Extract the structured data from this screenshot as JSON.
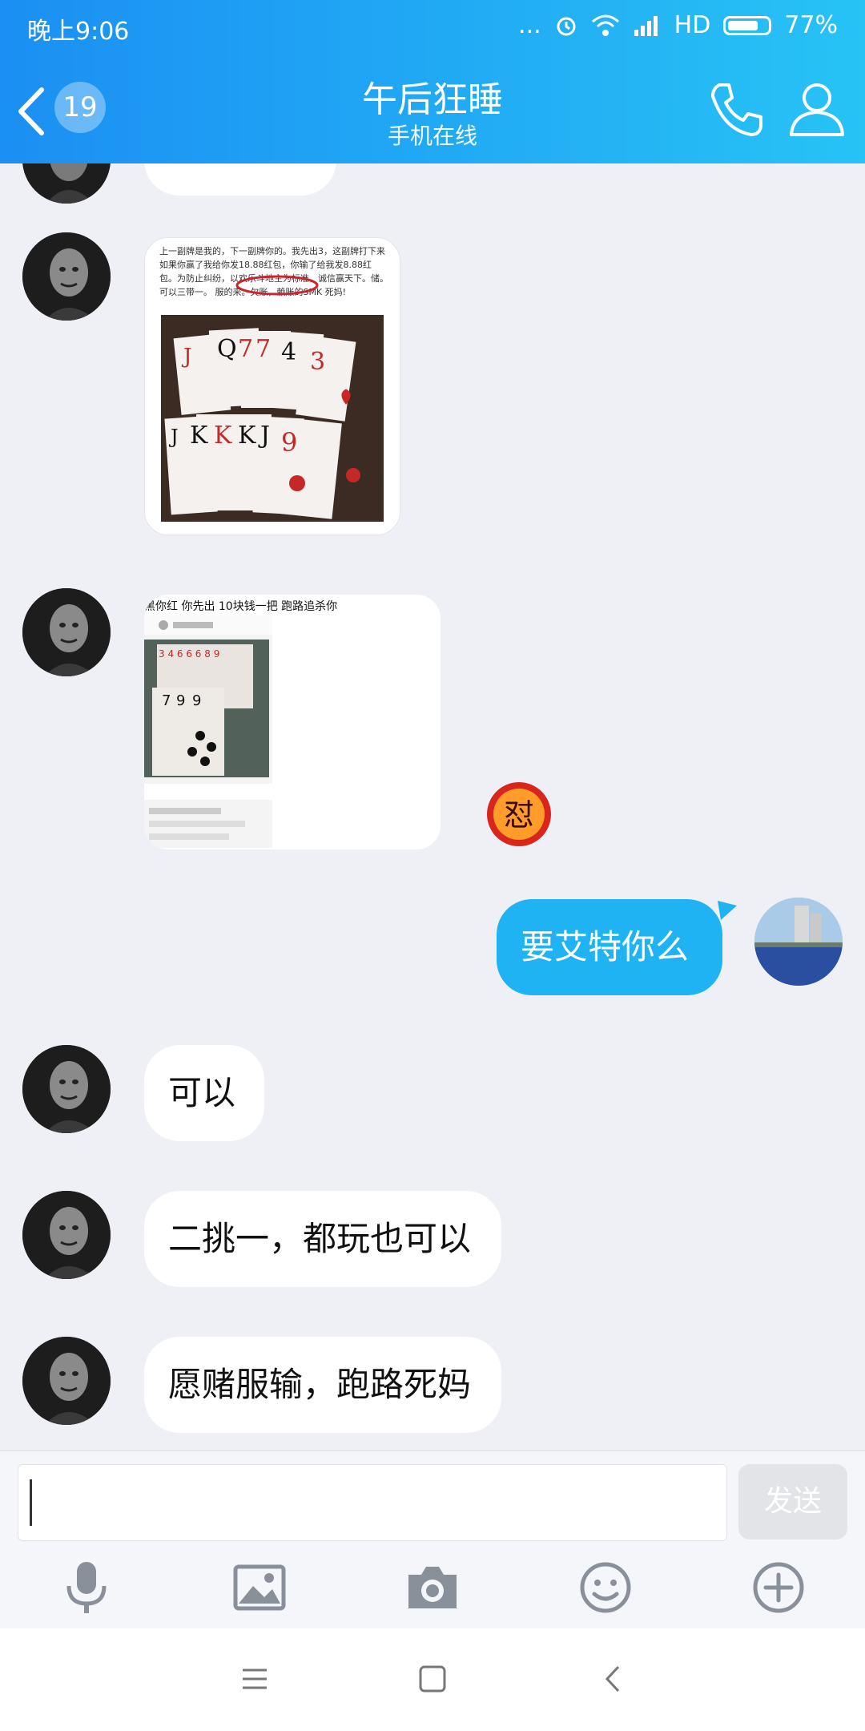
{
  "status_bar": {
    "time": "晚上9:06",
    "dots": "...",
    "network": "HD",
    "battery_level": 0.77,
    "battery_text": "77%"
  },
  "header": {
    "unread_count": "19",
    "contact_name": "午后狂睡",
    "contact_status": "手机在线",
    "icons": [
      "back-arrow-icon",
      "phone-icon",
      "profile-icon"
    ]
  },
  "messages": [
    {
      "sender": "contact",
      "type": "image",
      "image_text": "上一副牌是我的，下一副牌你的。我先出3，这副牌打下来如果你赢了我给你发18.88红包，你输了给我发8.88红包。为防止纠纷，以欢乐斗地主为标准，诚信赢天下。储。可以三带一。 服的来。欠账，赖账的SMK 死妈!"
    },
    {
      "sender": "contact",
      "type": "image",
      "image_text": "黑你红 你先出 10块钱一把 跑路追杀你"
    },
    {
      "sender": "me",
      "type": "text",
      "text": "要艾特你么"
    },
    {
      "sender": "contact",
      "type": "text",
      "text": "可以"
    },
    {
      "sender": "contact",
      "type": "text",
      "text": "二挑一，都玩也可以"
    },
    {
      "sender": "contact",
      "type": "text",
      "text": "愿赌服输，跑路死妈"
    }
  ],
  "sticker": {
    "text": "怼"
  },
  "input": {
    "value": "",
    "send_label": "发送"
  },
  "toolbar": [
    "microphone-icon",
    "image-icon",
    "camera-icon",
    "emoji-icon",
    "plus-icon"
  ],
  "navbar": [
    "menu-icon",
    "home-icon",
    "back-icon"
  ],
  "colors": {
    "header_start": "#1b8ff3",
    "header_end": "#27c3f5",
    "my_bubble": "#1fb3f3",
    "chat_background": "#eff0f5"
  }
}
